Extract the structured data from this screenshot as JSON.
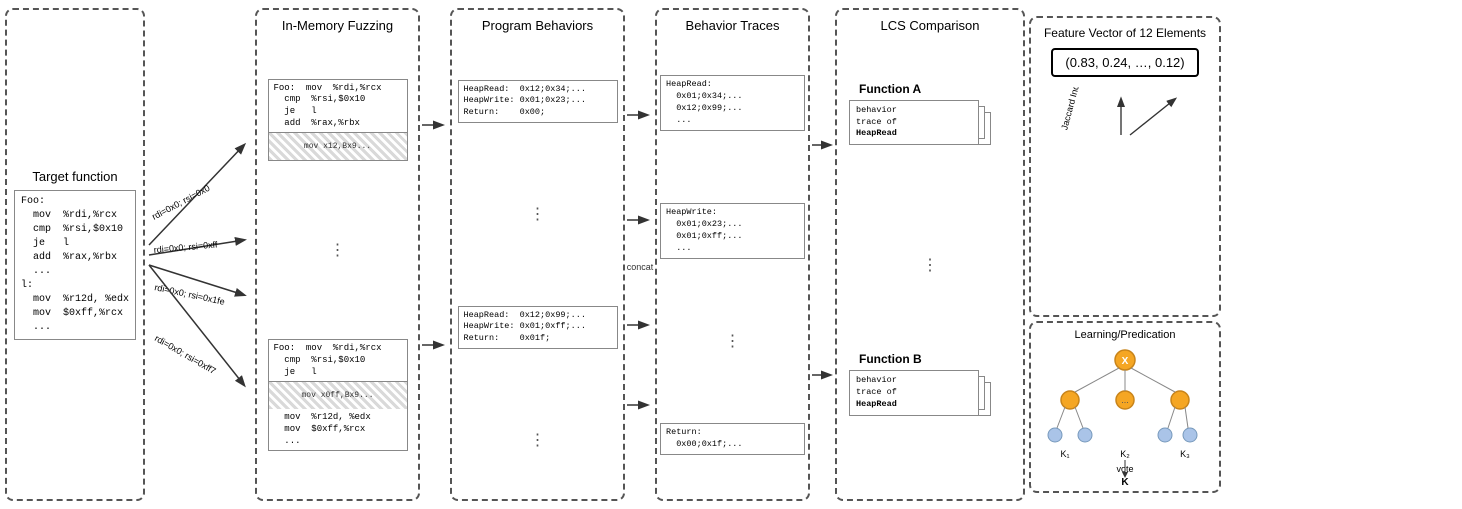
{
  "sections": {
    "target": {
      "title": "Target function",
      "code": "Foo:\n  mov  %rdi,%rcx\n  cmp  %rsi,$0x10\n  je   l\n  add  %rax,%rbx\n  ...\nl:\n  mov  %r12d, %edx\n  mov  $0xff,%rcx\n  ..."
    },
    "fuzzing": {
      "title": "In-Memory Fuzzing",
      "code_top1": "Foo:   mov  %rdi,%rcx\n   cmp  %rsi,$0x10\n   je   l\n   add  %rax,%rbx",
      "pattern1": "mov  x12,Bx9...",
      "code_top2": "Foo:   mov  %rdi,%rcx\n   cmp  %rsi,$0x10\n   je   l",
      "pattern2": "mov  x0ff,Bx9...",
      "arrow_labels": [
        "rdi=0x0; rsi=0x0",
        "rdi=0x0; rsi=0xff",
        "rdi=0x0; rsi=0x1fe",
        "rdi=0x0; rsi=0xff7"
      ]
    },
    "behaviors": {
      "title": "Program Behaviors",
      "box1": "HeapRead:  0x12;0x34;...\nHeapWrite: 0x01;0x23;...\nReturn:    0x00;",
      "box2": "...",
      "box3": "HeapRead:  0x12;0x99;...\nHeapWrite: 0x01;0xff;...\nReturn:    0x01f;",
      "box4": "..."
    },
    "traces": {
      "title": "Behavior Traces",
      "box1": "HeapRead:\n  0x01;0x34;...\n  0x12;0x99;...\n  ...",
      "box2": "HeapWrite:\n  0x01;0x23;...\n  0x01;0xff;...\n  ...",
      "box3": "...",
      "box4": "Return:\n  0x00;0x1f;...",
      "concat_label": "concat"
    },
    "lcs": {
      "title": "LCS Comparison",
      "funcA": {
        "label": "Function A",
        "box_text": "behavior\ntrace of\nHeapRead"
      },
      "funcB": {
        "label": "Function B",
        "box_text": "behavior\ntrace of\nHeapRead"
      }
    },
    "feature": {
      "title": "Feature Vector of 12 Elements",
      "vector_text": "(0.83, 0.24, …, 0.12)",
      "jaccard_label": "Jaccard Index",
      "learning": {
        "title": "Learning/Predication",
        "node_x": "X",
        "node_k1": "K₁",
        "node_k2": "K₂",
        "node_k3": "K₃",
        "vote_label": "vote",
        "node_k": "K",
        "dots": "..."
      }
    }
  }
}
